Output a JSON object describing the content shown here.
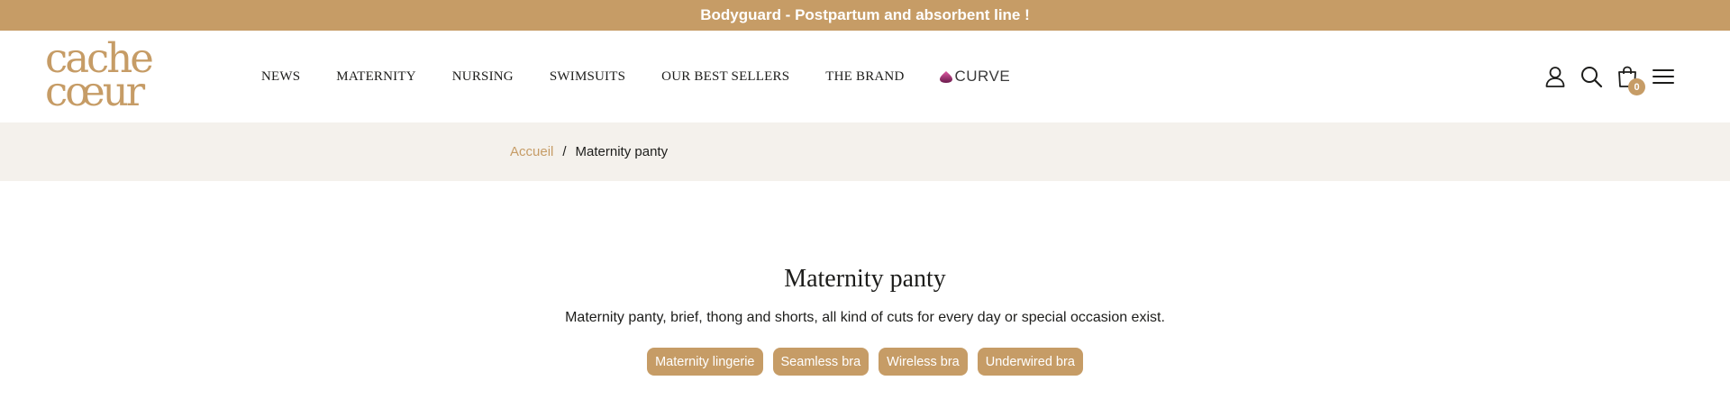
{
  "announcement": "Bodyguard - Postpartum and absorbent line !",
  "brand": {
    "line1": "cache",
    "line2": "cœur"
  },
  "nav": {
    "items": [
      "NEWS",
      "MATERNITY",
      "NURSING",
      "SWIMSUITS",
      "OUR BEST SELLERS",
      "THE BRAND"
    ],
    "curve_label": "CURVE"
  },
  "header_icons": [
    "account-icon",
    "search-icon",
    "cart-icon",
    "menu-icon"
  ],
  "cart": {
    "count": "0"
  },
  "breadcrumb": {
    "home": "Accueil",
    "separator": "/",
    "current": "Maternity panty"
  },
  "main": {
    "title": "Maternity panty",
    "description": "Maternity panty, brief, thong and shorts, all kind of cuts for every day or special occasion exist.",
    "tags": [
      "Maternity lingerie",
      "Seamless bra",
      "Wireless bra",
      "Underwired bra"
    ]
  },
  "colors": {
    "accent": "#c69c66",
    "breadcrumb_bg": "#f4f1ec",
    "text": "#1d1d1b",
    "curve_gradient": [
      "#e05aa3",
      "#6b1a4c"
    ]
  }
}
